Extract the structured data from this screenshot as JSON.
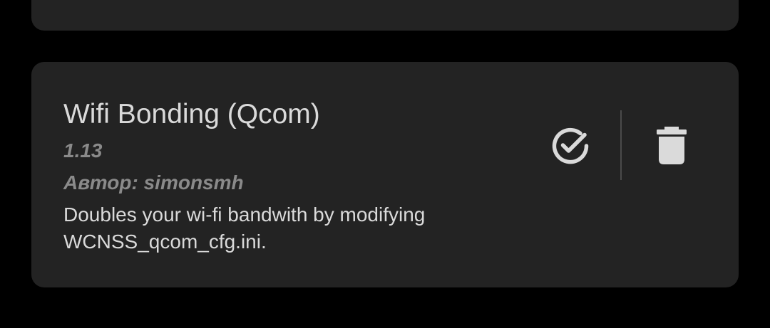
{
  "colors": {
    "background": "#000000",
    "card": "#232323",
    "primary_text": "#dadada",
    "secondary_text": "#8a8a8a",
    "icon": "#dadada",
    "divider": "#4a4a4a"
  },
  "module": {
    "name": "Wifi Bonding (Qcom)",
    "version": "1.13",
    "author": "Автор: simonsmh",
    "description_lines": [
      "Doubles your wi-fi bandwith by modifying",
      "WCNSS_qcom_cfg.ini."
    ],
    "actions": {
      "enable_icon": "check-circle-icon",
      "remove_icon": "trash-icon"
    }
  }
}
